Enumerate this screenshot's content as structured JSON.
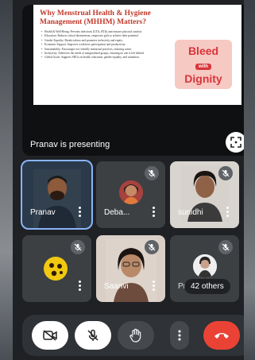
{
  "presentation": {
    "slide_title": "Why Menstrual Health & Hygiene Management (MHHM) Matters?",
    "slide_points": [
      "Health & Well-Being: Prevents infections (UTIs, RTIs) and ensures physical comfort.",
      "Education: Reduces school absenteeism, empowers girls to achieve their potential.",
      "Gender Equality: Breaks taboos and promotes inclusivity and equity.",
      "Economic Support: Improves workforce participation and productivity.",
      "Sustainability: Encourages eco-friendly menstrual practices, reducing waste.",
      "Inclusivity: Addresses the needs of marginalized groups, ensuring no one is left behind.",
      "Global Goals: Supports SDGs on health, education, gender equality, and sanitation."
    ],
    "logo": {
      "line1": "Bleed",
      "line2": "with",
      "line3": "Dignity"
    },
    "presenter_text": "Pranav is presenting"
  },
  "participants": [
    {
      "name": "Pranav",
      "muted": false,
      "selected": true
    },
    {
      "name": "Deba...",
      "muted": true,
      "selected": false
    },
    {
      "name": "sunidhi",
      "muted": true,
      "selected": false
    },
    {
      "name": "",
      "muted": true,
      "selected": false
    },
    {
      "name": "Saanvi",
      "muted": true,
      "selected": false
    },
    {
      "name": "Pr",
      "muted": true,
      "selected": false
    }
  ],
  "others_label": "42 others",
  "colors": {
    "end_call": "#ea4335",
    "accent": "#8ab4f8"
  },
  "controls": [
    "camera-off-icon",
    "mic-off-icon",
    "raise-hand-icon",
    "more-vert-icon",
    "end-call-icon"
  ]
}
